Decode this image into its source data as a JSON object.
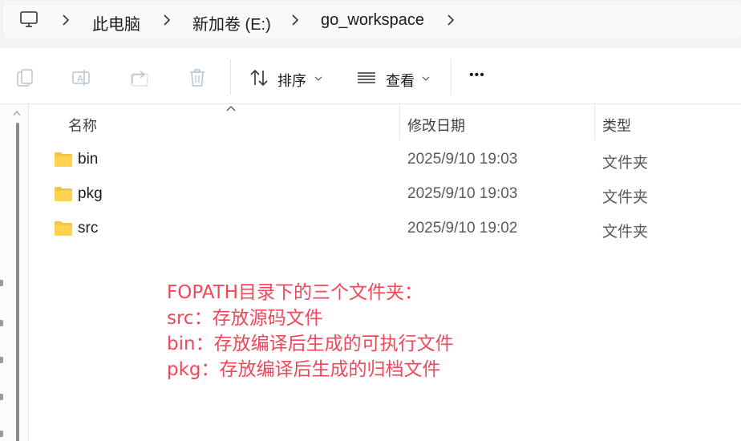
{
  "breadcrumb": {
    "items": [
      "此电脑",
      "新加卷 (E:)",
      "go_workspace"
    ]
  },
  "toolbar": {
    "sort_label": "排序",
    "view_label": "查看",
    "more_label": "•••"
  },
  "columns": {
    "name": "名称",
    "date": "修改日期",
    "type": "类型"
  },
  "files": [
    {
      "name": "bin",
      "date": "2025/9/10 19:03",
      "type": "文件夹"
    },
    {
      "name": "pkg",
      "date": "2025/9/10 19:03",
      "type": "文件夹"
    },
    {
      "name": "src",
      "date": "2025/9/10 19:02",
      "type": "文件夹"
    }
  ],
  "annotation": {
    "lines": [
      "FOPATH目录下的三个文件夹：",
      "src：存放源码文件",
      "bin：存放编译后生成的可执行文件",
      "pkg：存放编译后生成的归档文件"
    ]
  },
  "colors": {
    "annotation": "#f0475a",
    "folder": "#f4c542",
    "accent": "#0067c0"
  },
  "icons": {
    "location": "computer-icon",
    "toolbar": [
      "copy-icon",
      "rename-icon",
      "share-icon",
      "delete-icon",
      "sort-icon",
      "view-icon",
      "more-icon"
    ],
    "file": "folder-icon"
  }
}
